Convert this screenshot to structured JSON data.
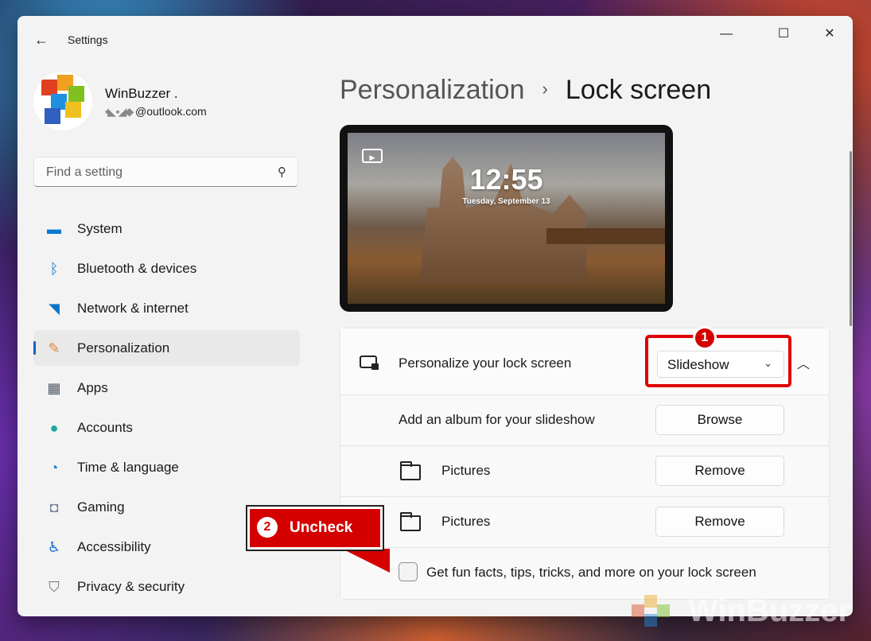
{
  "app": {
    "title": "Settings"
  },
  "window_controls": {
    "minimize": "—",
    "maximize": "☐",
    "close": "✕"
  },
  "profile": {
    "name": "WinBuzzer .",
    "email": "@outlook.com"
  },
  "search": {
    "placeholder": "Find a setting"
  },
  "nav": [
    {
      "label": "System",
      "icon": "monitor-icon",
      "color": "#0078d4"
    },
    {
      "label": "Bluetooth & devices",
      "icon": "bluetooth-icon",
      "color": "#0078d4"
    },
    {
      "label": "Network & internet",
      "icon": "wifi-icon",
      "color": "#0a74c9"
    },
    {
      "label": "Personalization",
      "icon": "paintbrush-icon",
      "color": "#e08a3a",
      "active": true
    },
    {
      "label": "Apps",
      "icon": "apps-icon",
      "color": "#505a66"
    },
    {
      "label": "Accounts",
      "icon": "person-icon",
      "color": "#1aa89c"
    },
    {
      "label": "Time & language",
      "icon": "globe-clock-icon",
      "color": "#1a7ad0"
    },
    {
      "label": "Gaming",
      "icon": "gamepad-icon",
      "color": "#7a8a9a"
    },
    {
      "label": "Accessibility",
      "icon": "accessibility-icon",
      "color": "#1a6fd0"
    },
    {
      "label": "Privacy & security",
      "icon": "shield-icon",
      "color": "#6a7480"
    }
  ],
  "breadcrumb": {
    "parent": "Personalization",
    "separator": "›",
    "current": "Lock screen"
  },
  "preview": {
    "time": "12:55",
    "date": "Tuesday, September 13"
  },
  "lock_screen": {
    "personalize_label": "Personalize your lock screen",
    "personalize_value": "Slideshow",
    "album_label": "Add an album for your slideshow",
    "browse_label": "Browse",
    "folders": [
      {
        "label": "Pictures",
        "action": "Remove"
      },
      {
        "label": "Pictures",
        "action": "Remove"
      }
    ],
    "fun_facts_label": "Get fun facts, tips, tricks, and more on your lock screen",
    "fun_facts_checked": false
  },
  "annotations": {
    "step1": "1",
    "step2": "2",
    "step2_text": "Uncheck",
    "highlight_color": "#e00000"
  },
  "watermark": {
    "text": "WinBuzzer"
  }
}
